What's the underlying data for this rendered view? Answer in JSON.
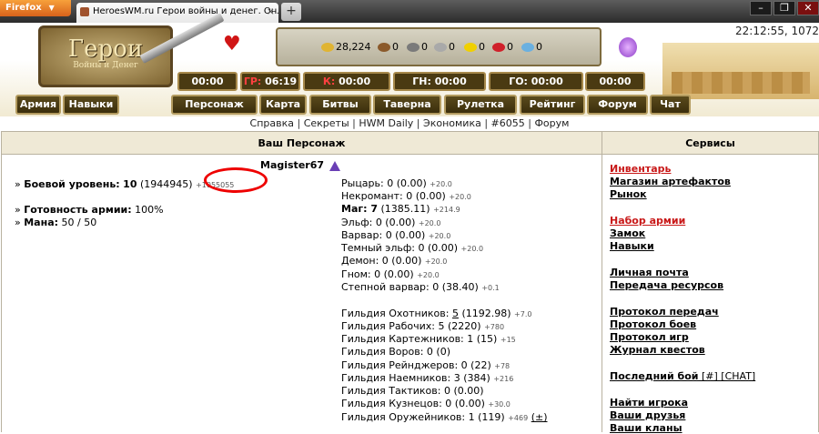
{
  "browser": {
    "menu_label": "Firefox",
    "tab_title": "HeroesWM.ru Герои войны и денег. Онла...",
    "new_tab": "+",
    "min": "–",
    "max": "❐",
    "close": "✕"
  },
  "header": {
    "logo_title": "Герои",
    "logo_subtitle": "Войны и Денег",
    "clock": "22:12:55, 1072",
    "resources": [
      {
        "icon": "gold-icon",
        "value": "28,224",
        "color": "#e0b432"
      },
      {
        "icon": "wood-icon",
        "value": "0",
        "color": "#8b5a2b"
      },
      {
        "icon": "ore-icon",
        "value": "0",
        "color": "#7a7a7a"
      },
      {
        "icon": "mercury-icon",
        "value": "0",
        "color": "#a9a9a9"
      },
      {
        "icon": "sulfur-icon",
        "value": "0",
        "color": "#f0d000"
      },
      {
        "icon": "crystal-icon",
        "value": "0",
        "color": "#d0202a"
      },
      {
        "icon": "gems-icon",
        "value": "0",
        "color": "#6ab0e0"
      }
    ],
    "timers": [
      {
        "label": "00:00"
      },
      {
        "prefix": "ГР:",
        "label": " 06:19"
      },
      {
        "prefix": "К:",
        "label": " 00:00"
      },
      {
        "label": "ГН: 00:00"
      },
      {
        "label": "ГО: 00:00"
      },
      {
        "label": "00:00"
      }
    ],
    "nav": [
      "Армия",
      "Навыки",
      "Персонаж",
      "Карта",
      "Битвы",
      "Таверна",
      "Рулетка",
      "Рейтинг",
      "Форум",
      "Чат"
    ]
  },
  "links": [
    "Справка",
    "Секреты",
    "HWM Daily",
    "Экономика",
    "#6055",
    "Форум"
  ],
  "left": {
    "title": "Ваш Персонаж",
    "nick": "Magister67",
    "combat_label": "Боевой уровень:",
    "combat_level": "10",
    "combat_exp": "(1944945)",
    "combat_need": "+1055055",
    "army_label": "Готовность армии:",
    "army_value": "100%",
    "mana_label": "Мана:",
    "mana_value": "50 / 50",
    "bullet": "»",
    "factions": [
      {
        "name": "Рыцарь:",
        "value": "0 (0.00)",
        "plus": "+20.0"
      },
      {
        "name": "Некромант:",
        "value": "0 (0.00)",
        "plus": "+20.0"
      },
      {
        "name": "Маг:",
        "value": "7",
        "paren": "(1385.11)",
        "plus": "+214.9",
        "bold": true
      },
      {
        "name": "Эльф:",
        "value": "0 (0.00)",
        "plus": "+20.0"
      },
      {
        "name": "Варвар:",
        "value": "0 (0.00)",
        "plus": "+20.0"
      },
      {
        "name": "Темный эльф:",
        "value": "0 (0.00)",
        "plus": "+20.0"
      },
      {
        "name": "Демон:",
        "value": "0 (0.00)",
        "plus": "+20.0"
      },
      {
        "name": "Гном:",
        "value": "0 (0.00)",
        "plus": "+20.0"
      },
      {
        "name": "Степной варвар:",
        "value": "0 (38.40)",
        "plus": "+0.1"
      }
    ],
    "guilds": [
      {
        "name": "Гильдия Охотников:",
        "level": "5",
        "value": "(1192.98)",
        "plus": "+7.0",
        "link": true
      },
      {
        "name": "Гильдия Рабочих:",
        "level": "5",
        "value": "(2220)",
        "plus": "+780"
      },
      {
        "name": "Гильдия Картежников:",
        "level": "1",
        "value": "(15)",
        "plus": "+15"
      },
      {
        "name": "Гильдия Воров:",
        "level": "0",
        "value": "(0)",
        "plus": ""
      },
      {
        "name": "Гильдия Рейнджеров:",
        "level": "0",
        "value": "(22)",
        "plus": "+78"
      },
      {
        "name": "Гильдия Наемников:",
        "level": "3",
        "value": "(384)",
        "plus": "+216"
      },
      {
        "name": "Гильдия Тактиков:",
        "level": "0",
        "value": "(0.00)",
        "plus": ""
      },
      {
        "name": "Гильдия Кузнецов:",
        "level": "0",
        "value": "(0.00)",
        "plus": "+30.0"
      },
      {
        "name": "Гильдия Оружейников:",
        "level": "1",
        "value": "(119)",
        "plus": "+469",
        "extra": "(±)"
      }
    ]
  },
  "right": {
    "title": "Сервисы",
    "links": [
      {
        "label": "Инвентарь",
        "hot": true
      },
      {
        "label": "Магазин артефактов"
      },
      {
        "label": "Рынок"
      },
      {
        "label": "Набор армии",
        "hot": true
      },
      {
        "label": "Замок"
      },
      {
        "label": "Навыки"
      },
      {
        "label": "Личная почта"
      },
      {
        "label": "Передача ресурсов"
      },
      {
        "label": "Протокол передач"
      },
      {
        "label": "Протокол боев"
      },
      {
        "label": "Протокол игр"
      },
      {
        "label": "Журнал квестов"
      },
      {
        "label": "Последний бой"
      },
      {
        "label": "Найти игрока"
      },
      {
        "label": "Ваши друзья"
      },
      {
        "label": "Ваши кланы"
      }
    ],
    "last_battle_extra": "[#] [CHAT]"
  }
}
